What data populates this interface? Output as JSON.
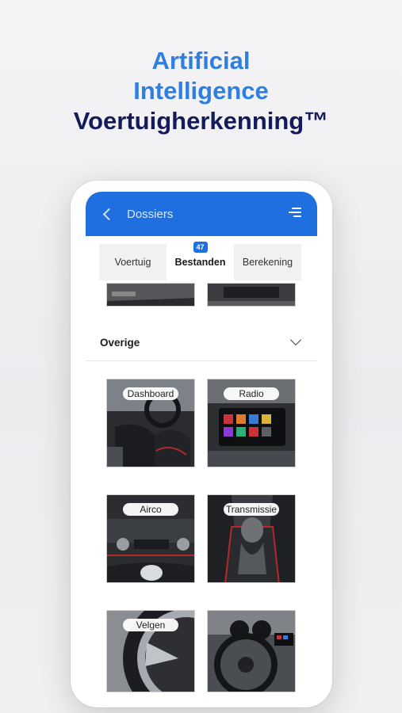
{
  "headline": {
    "line1": "Artificial",
    "line2": "Intelligence",
    "line3": "Voertuigherkenning™"
  },
  "appbar": {
    "back_icon": "chevron-left-icon",
    "title": "Dossiers",
    "menu_icon": "filter-menu-icon"
  },
  "tabs": [
    {
      "label": "Voertuig",
      "active": false
    },
    {
      "label": "Bestanden",
      "active": true,
      "badge": "47"
    },
    {
      "label": "Berekening",
      "active": false
    }
  ],
  "section": {
    "title": "Overige",
    "chevron_icon": "chevron-down-icon"
  },
  "photos": [
    {
      "label": "Dashboard"
    },
    {
      "label": "Radio"
    },
    {
      "label": "Airco"
    },
    {
      "label": "Transmissie"
    },
    {
      "label": "Velgen"
    },
    {
      "label": ""
    }
  ],
  "colors": {
    "accent": "#1f6fe0",
    "headline_blue": "#2f7fe0",
    "headline_navy": "#141a5a"
  }
}
